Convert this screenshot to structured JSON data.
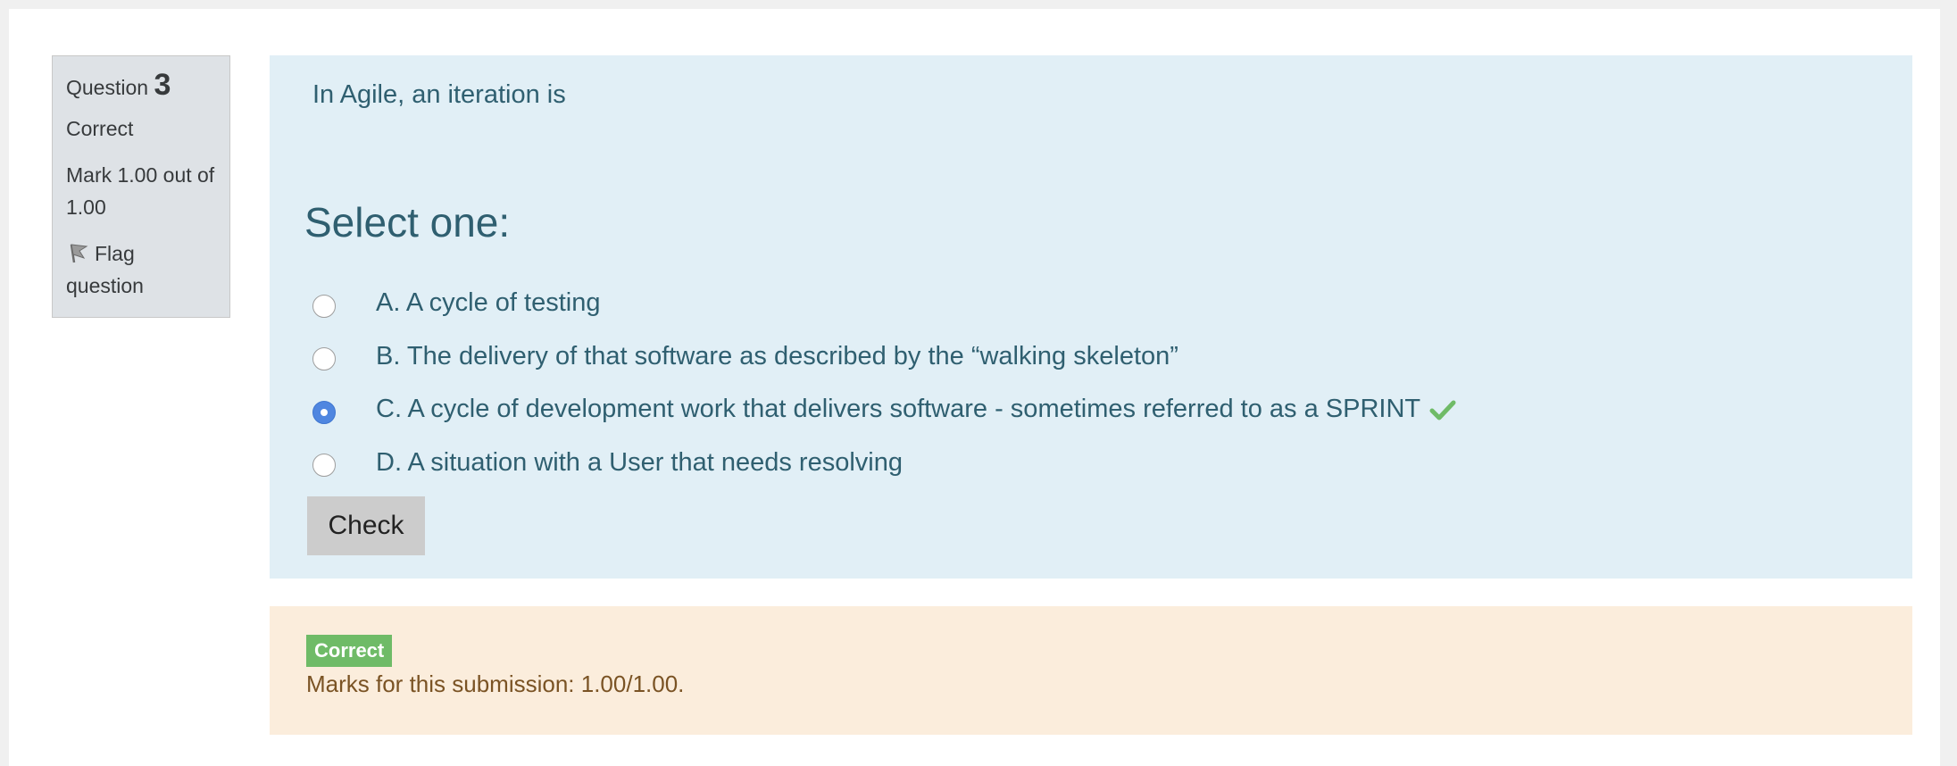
{
  "question_info": {
    "question_label": "Question",
    "question_number": "3",
    "state": "Correct",
    "grade": "Mark 1.00 out of 1.00",
    "flag_label": "Flag question"
  },
  "question": {
    "text": "In Agile, an iteration is",
    "prompt": "Select one:",
    "options": [
      {
        "label": "A. A cycle of testing",
        "selected": false
      },
      {
        "label": "B. The delivery of that software as described by the “walking skeleton”",
        "selected": false
      },
      {
        "label": "C. A cycle of development work that delivers software - sometimes referred to as a SPRINT",
        "selected": true,
        "correct_icon": "check-icon"
      },
      {
        "label": "D. A situation with a User that needs resolving",
        "selected": false
      }
    ],
    "check_button": "Check"
  },
  "outcome": {
    "badge": "Correct",
    "marks": "Marks for this submission: 1.00/1.00."
  },
  "colors": {
    "info_bg": "#dee2e6",
    "question_bg": "#e1eff6",
    "outcome_bg": "#fbeddc",
    "badge_bg": "#6fbb67",
    "radio_selected": "#4f86e0",
    "text_primary": "#2f5f70",
    "marks_text": "#7a5324"
  }
}
